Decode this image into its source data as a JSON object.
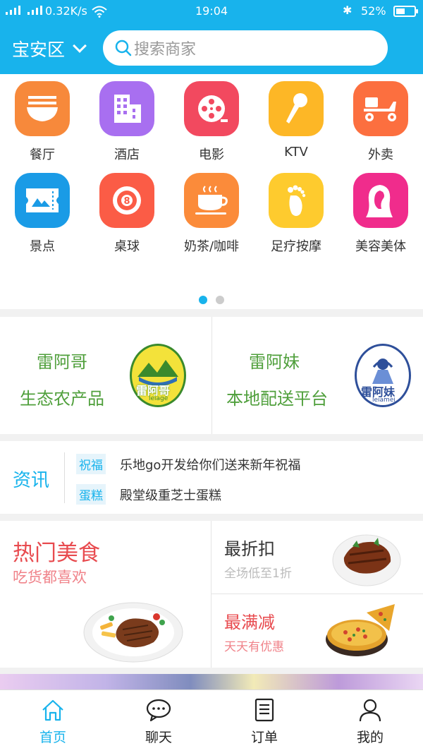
{
  "status_bar": {
    "network_speed": "0.32K/s",
    "time": "19:04",
    "battery_percent": "52%",
    "battery_level": 0.52
  },
  "header": {
    "city": "宝安区",
    "search_placeholder": "搜索商家"
  },
  "categories": [
    {
      "label": "餐厅",
      "color": "#f7893b",
      "icon": "noodle-bowl-icon"
    },
    {
      "label": "酒店",
      "color": "#a86ff0",
      "icon": "hotel-building-icon"
    },
    {
      "label": "电影",
      "color": "#f2495f",
      "icon": "film-reel-icon"
    },
    {
      "label": "KTV",
      "color": "#fdb726",
      "icon": "microphone-icon"
    },
    {
      "label": "外卖",
      "color": "#fc6f3f",
      "icon": "scooter-icon"
    },
    {
      "label": "景点",
      "color": "#1a9be6",
      "icon": "ticket-icon"
    },
    {
      "label": "桌球",
      "color": "#fb5c46",
      "icon": "billiard-ball-icon"
    },
    {
      "label": "奶茶/咖啡",
      "color": "#fb8b3a",
      "icon": "coffee-cup-icon"
    },
    {
      "label": "足疗按摩",
      "color": "#fecb2e",
      "icon": "foot-icon"
    },
    {
      "label": "美容美体",
      "color": "#f02c8c",
      "icon": "woman-profile-icon"
    }
  ],
  "pager": {
    "pages": 2,
    "active": 0
  },
  "promos": [
    {
      "line1": "雷阿哥",
      "line2": "生态农产品",
      "logo_text": "雷阿哥",
      "logo_sub": "leiage"
    },
    {
      "line1": "雷阿妹",
      "line2": "本地配送平台",
      "logo_text": "雷阿妹",
      "logo_sub": "leiamei"
    }
  ],
  "news": {
    "title": "资讯",
    "items": [
      {
        "tag": "祝福",
        "text": "乐地go开发给你们送来新年祝福"
      },
      {
        "tag": "蛋糕",
        "text": "殿堂级重芝士蛋糕"
      }
    ]
  },
  "food": {
    "main_title": "热门美食",
    "main_subtitle": "吃货都喜欢",
    "discount_title": "最折扣",
    "discount_subtitle": "全场低至1折",
    "full_cut_title": "最满减",
    "full_cut_subtitle": "天天有优惠",
    "colors": {
      "main": "#e84b4f",
      "discount_title": "#333333",
      "discount_sub": "#bbbbbb",
      "cut_title": "#e84b4f",
      "cut_sub": "#f0838a"
    }
  },
  "tabs": [
    {
      "label": "首页",
      "icon": "home-icon",
      "active": true
    },
    {
      "label": "聊天",
      "icon": "chat-bubble-icon",
      "active": false
    },
    {
      "label": "订单",
      "icon": "order-list-icon",
      "active": false
    },
    {
      "label": "我的",
      "icon": "user-icon",
      "active": false
    }
  ],
  "accent_color": "#18b3ec"
}
